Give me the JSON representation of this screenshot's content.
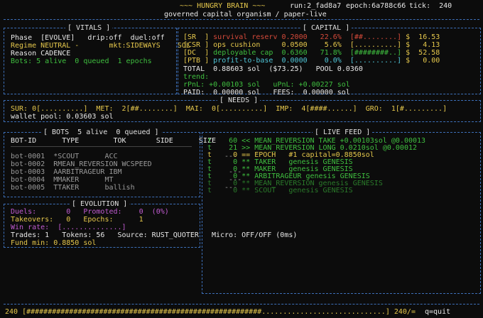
{
  "header": {
    "title": "~~~ HUNGRY BRAIN ~~~",
    "run": "run:2_fad8a7",
    "epoch": "epoch:6a788c66",
    "tick": "tick:  240",
    "subtitle": "governed capital organism / paper-live"
  },
  "vitals": {
    "title": "[ VITALS ]",
    "line1": "Phase  [EVOLVE]   drip:off  duel:off",
    "line2": "Regime NEUTRAL -       mkt:SIDEWAYS    SOL",
    "line3": "Reason CADENCE",
    "line4": "Bots: 5 alive  0 queued  1 epochs"
  },
  "capital": {
    "title": "[ CAPITAL ]",
    "rows": [
      {
        "tag": "[SR  ]",
        "name": "survival reserv",
        "val": "0.2000",
        "pct": "22.6%",
        "bar": "[##........]",
        "usd": "$  16.53",
        "color": "#d54a3a"
      },
      {
        "tag": "[CSR ]",
        "name": "ops cushion    ",
        "val": "0.0500",
        "pct": " 5.6%",
        "bar": "[..........]",
        "usd": "$   4.13",
        "color": "#e6c84c"
      },
      {
        "tag": "[DC  ]",
        "name": "deployable cap ",
        "val": "0.6360",
        "pct": "71.8%",
        "bar": "[########..]",
        "usd": "$  52.58",
        "color": "#3fbf3f"
      },
      {
        "tag": "[PTB ]",
        "name": "profit-to-base ",
        "val": "0.0000",
        "pct": " 0.0%",
        "bar": "[..........]",
        "usd": "$   0.00",
        "color": "#4fc6d8"
      }
    ],
    "total": "TOTAL  0.88603 sol  ($73.25)   POOL 0.0360",
    "trend": "trend:",
    "pnl": "rPnL: +0.00103 sol   uPnL: +0.00227 sol",
    "paid": "PAID:  0.00000 sol   FEES:  0.00000 sol"
  },
  "needs": {
    "title": "[ NEEDS ]",
    "line": "SUR: 0[..........]  MET:  2[##........]  MAI:  0[..........]  IMP:  4[####......]  GRO:  1[#.........]",
    "wallet": "wallet pool: 0.03603 sol"
  },
  "bots": {
    "title": "[ BOTS  5 alive  0 queued ]",
    "columns": "BOT-ID      TYPE        TOK       SIDE      SIZE",
    "rows": [
      "bot-0001  *SCOUT      ACC                         ---",
      "bot-0002  RMEAN_REVERSION WCSPEED",
      "bot-0003  AARBITRAGEUR IBM                         ---",
      "bot-0004  MMAKER      MT                           ---",
      "bot-0005  TTAKER      ballish                     ---"
    ]
  },
  "evolution": {
    "title": "[ EVOLUTION ]",
    "duels": "Duels:       0   Promoted:    0  (0%)",
    "takeovers": "Takeovers:   0   Epochs:      1",
    "winrate": "Win rate:  [..............]",
    "trades": "Trades: 1   Tokens: 56   Source: RUST_QUOTER   Micro: OFF/OFF (0ms)",
    "fund": "Fund min: 0.8850 sol"
  },
  "feed": {
    "title": "[ LIVE FEED ]",
    "lines": [
      {
        "text": "t    60 << MEAN_REVERSION TAKE +0.00103sol @0.00013",
        "color": "#3fbf3f"
      },
      {
        "text": "t    21 >> MEAN_REVERSION LONG 0.0210sol @0.00012",
        "color": "#3fbf3f"
      },
      {
        "text": "t     0 == EPOCH   #1 capital=0.8850sol",
        "color": "#e6c84c"
      },
      {
        "text": "t     0 ** TAKER   genesis GENESIS",
        "color": "#3fbf3f"
      },
      {
        "text": "t     0 ** MAKER   genesis GENESIS",
        "color": "#3fbf3f"
      },
      {
        "text": "t     0 ** ARBITRAGEUR genesis GENESIS",
        "color": "#3fbf3f"
      },
      {
        "text": "t     0 ** MEAN_REVERSION genesis GENESIS",
        "color": "#2a7a2a"
      },
      {
        "text": "t     0 ** SCOUT   genesis GENESIS",
        "color": "#2a7a2a"
      }
    ]
  },
  "footer": {
    "progress_label": "240 [#######################################################.............................] 240/=",
    "progress_fraction": 0.66,
    "quit": "q=quit"
  }
}
